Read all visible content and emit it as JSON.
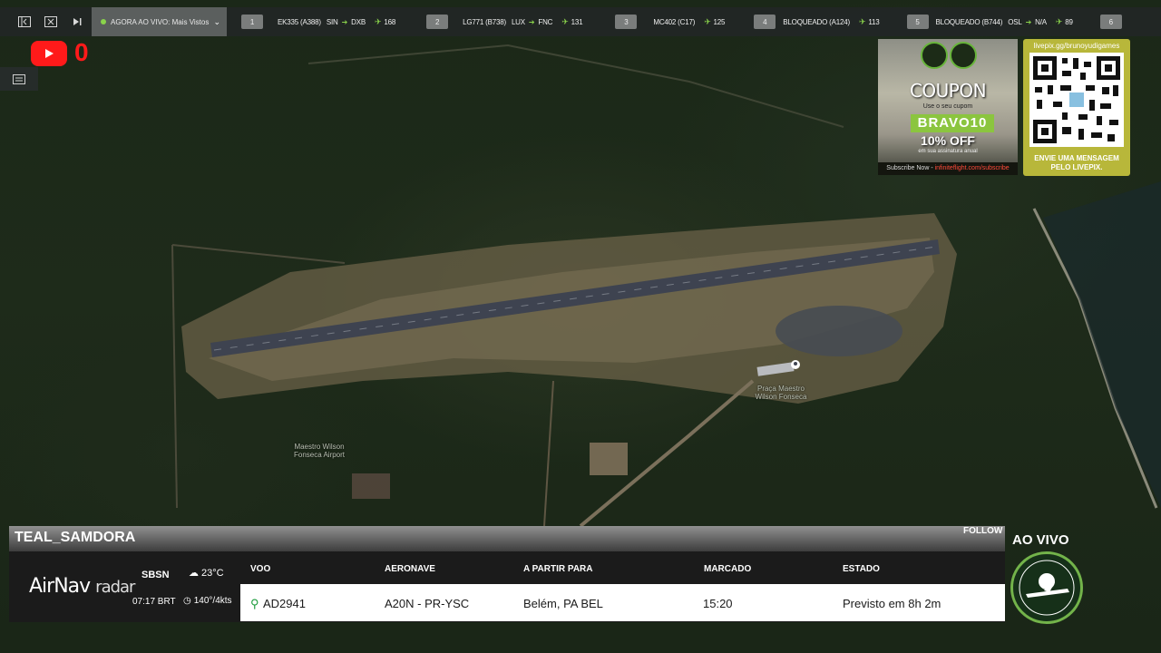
{
  "topbar": {
    "live_label": "AGORA AO VIVO: Mais Vistos",
    "flights": [
      {
        "num": "1",
        "callsign": "EK335 (A388)",
        "from": "SIN",
        "to": "DXB",
        "viewers": "168"
      },
      {
        "num": "2",
        "callsign": "LG771 (B738)",
        "from": "LUX",
        "to": "FNC",
        "viewers": "131"
      },
      {
        "num": "3",
        "callsign": "MC402 (C17)",
        "from": "",
        "to": "",
        "viewers": "125"
      },
      {
        "num": "4",
        "callsign": "BLOQUEADO (A124)",
        "from": "",
        "to": "",
        "viewers": "113"
      },
      {
        "num": "5",
        "callsign": "BLOQUEADO (B744)",
        "from": "OSL",
        "to": "N/A",
        "viewers": "89"
      },
      {
        "num": "6",
        "callsign": "",
        "from": "",
        "to": "",
        "viewers": ""
      }
    ]
  },
  "youtube": {
    "count": "0"
  },
  "map": {
    "labels": {
      "airport_area": "Maestro Wilson Fonseca Airport",
      "poi": "Praça Maestro Wilson Fonseca"
    }
  },
  "coupon": {
    "title": "COUPON",
    "subtitle": "Use o seu cupom",
    "code": "BRAVO10",
    "discount": "10% OFF",
    "small": "em sua assinatura anual",
    "footer_left": "Subscribe Now - ",
    "footer_link": "infiniteflight.com/subscribe"
  },
  "livepix": {
    "url": "livepix.gg/brunoyudigames",
    "message_line1": "ENVIE UMA MENSAGEM",
    "message_line2": "PELO LIVEPIX."
  },
  "panel": {
    "username": "TEAL_SAMDORA",
    "follow": "FOLLOW",
    "brand_main": "AirNav",
    "brand_sub": "radar",
    "airport_code": "SBSN",
    "local_time": "07:17 BRT",
    "temperature": "23°C",
    "wind": "140°/4kts",
    "headers": {
      "flight": "VOO",
      "aircraft": "AERONAVE",
      "from": "A PARTIR PARA",
      "scheduled": "MARCADO",
      "status": "ESTADO"
    },
    "row": {
      "flight": "AD2941",
      "aircraft": "A20N - PR-YSC",
      "from": "Belém, PA BEL",
      "scheduled": "15:20",
      "status": "Previsto em 8h 2m"
    }
  },
  "badge": {
    "live": "AO VIVO"
  },
  "colors": {
    "accent_green": "#8ad34b",
    "youtube_red": "#ff1a1a",
    "livepix_yellow": "#b8b73a"
  }
}
